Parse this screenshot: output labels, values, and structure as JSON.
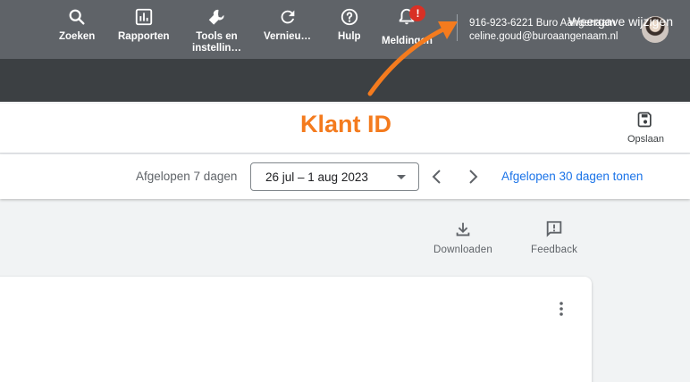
{
  "topbar": {
    "items": [
      {
        "label": "Zoeken"
      },
      {
        "label": "Rapporten"
      },
      {
        "label_line1": "Tools en",
        "label_line2": "instellin…"
      },
      {
        "label": "Vernieu…"
      },
      {
        "label": "Hulp"
      },
      {
        "label": "Meldingen",
        "badge": "!"
      }
    ],
    "account": {
      "line1": "916-923-6221 Buro Aangenaam",
      "line2": "celine.goud@buroaangenaam.nl"
    }
  },
  "strip": {
    "button_label": "Weergave wijzigen"
  },
  "header": {
    "annotation": "Klant ID",
    "save_label": "Opslaan"
  },
  "daterange": {
    "period_label": "Afgelopen 7 dagen",
    "selected_value": "26 jul – 1 aug 2023",
    "show_30_label": "Afgelopen 30 dagen tonen"
  },
  "tools": {
    "download_label": "Downloaden",
    "feedback_label": "Feedback"
  },
  "colors": {
    "topbar": "#5f6368",
    "strip": "#3c4043",
    "accent_link": "#1a73e8",
    "annotation": "#f47b1e",
    "badge": "#d93025"
  },
  "icons": [
    "search-icon",
    "bar-chart-icon",
    "wrench-icon",
    "refresh-icon",
    "help-icon",
    "bell-icon",
    "save-icon",
    "chevron-left-icon",
    "chevron-right-icon",
    "download-icon",
    "feedback-icon",
    "more-vert-icon"
  ]
}
